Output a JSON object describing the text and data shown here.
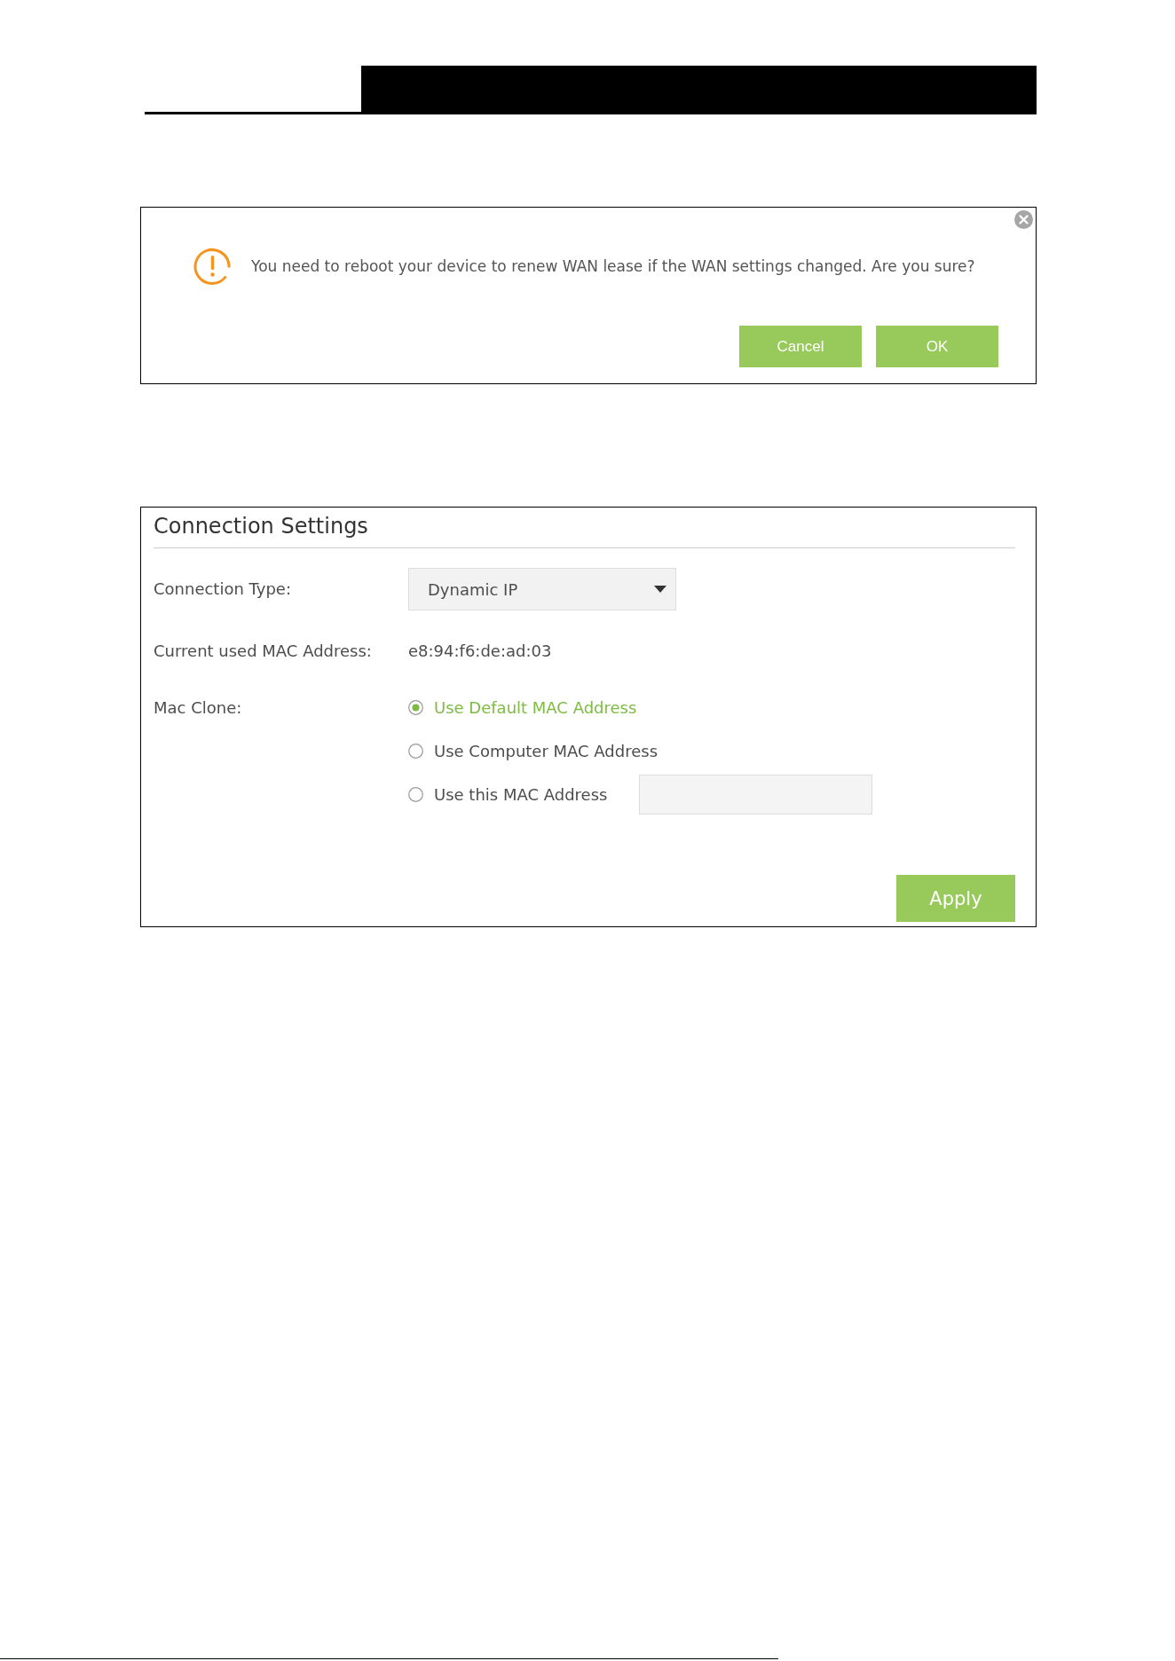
{
  "dialog": {
    "message": "You need to reboot your device to renew WAN lease if the WAN settings changed. Are you sure?",
    "buttons": [
      {
        "label": "Cancel"
      },
      {
        "label": "OK"
      }
    ]
  },
  "connection_settings": {
    "title": "Connection Settings",
    "fields": [
      {
        "kind": "select",
        "label": "Connection Type:",
        "value": "Dynamic IP"
      },
      {
        "kind": "text",
        "label": "Current used MAC Address:",
        "value": "e8:94:f6:de:ad:03"
      },
      {
        "kind": "radio_group",
        "label": "Mac Clone:",
        "options": [
          {
            "kind": "plain",
            "label": "Use Default MAC Address",
            "selected": true
          },
          {
            "kind": "plain",
            "label": "Use Computer MAC Address",
            "selected": false
          },
          {
            "kind": "with_input",
            "label": "Use this MAC Address",
            "selected": false
          }
        ]
      }
    ],
    "apply_button": "Apply"
  }
}
